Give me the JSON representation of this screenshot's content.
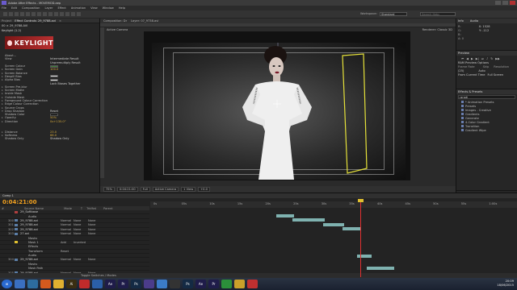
{
  "window": {
    "title": "Adobe After Effects - MOVEMOD.aep"
  },
  "menu": [
    "File",
    "Edit",
    "Composition",
    "Layer",
    "Effect",
    "Animation",
    "View",
    "Window",
    "Help"
  ],
  "toolbar": {
    "workspace_label": "Workspace:",
    "workspace": "Standard",
    "search_placeholder": "Search Help"
  },
  "left_panel": {
    "tabs": [
      "Project",
      "Effect Controls: 29_9788.avi",
      "×"
    ],
    "layer": "00 × 29_9788.AVI",
    "effect_name": "Keylight (1.2)",
    "banner": "KEYLIGHT",
    "properties": [
      {
        "name": "About...",
        "value": "",
        "swatch": "",
        "tw": ""
      },
      {
        "name": "View",
        "value": "Intermediate Result",
        "swatch": "",
        "tw": ""
      },
      {
        "name": "",
        "value": "Unpremultiply Result",
        "swatch": "",
        "tw": ""
      },
      {
        "name": "Screen Colour",
        "value": "",
        "swatch": "#3e7f3a",
        "tw": ""
      },
      {
        "name": "Screen Gain",
        "value": "100.0",
        "swatch": "",
        "tw": "▸"
      },
      {
        "name": "Screen Balance",
        "value": "",
        "swatch": "",
        "tw": "▸"
      },
      {
        "name": "Despill Bias",
        "value": "",
        "swatch": "#d8d8d8",
        "tw": "▸"
      },
      {
        "name": "Alpha Bias",
        "value": "",
        "swatch": "#d8d8d8",
        "tw": "▸"
      },
      {
        "name": "",
        "value": "Lock Biases Together",
        "swatch": "",
        "tw": ""
      },
      {
        "name": "Screen Pre-blur",
        "value": "",
        "swatch": "",
        "tw": "▸"
      },
      {
        "name": "Screen Matte",
        "value": "",
        "swatch": "",
        "tw": "▸"
      },
      {
        "name": "Inside Mask",
        "value": "",
        "swatch": "",
        "tw": "▸"
      },
      {
        "name": "Outside Mask",
        "value": "",
        "swatch": "",
        "tw": "▸"
      },
      {
        "name": "Foreground Colour Correction",
        "value": "",
        "swatch": "",
        "tw": "▸"
      },
      {
        "name": "Edge Colour Correction",
        "value": "",
        "swatch": "",
        "tw": "▸"
      },
      {
        "name": "Source Crops",
        "value": "",
        "swatch": "",
        "tw": "▸"
      },
      {
        "name": "Drop Shadow",
        "value": "Reset",
        "swatch": "",
        "tw": "▾"
      },
      {
        "name": "Shadow Color",
        "value": "",
        "swatch": "#000000",
        "tw": ""
      },
      {
        "name": "Opacity",
        "value": "50%",
        "swatch": "",
        "tw": "▸"
      },
      {
        "name": "Direction",
        "value": "0x+135.0°",
        "swatch": "",
        "tw": "▸"
      },
      {
        "name": "",
        "value": "",
        "swatch": "",
        "tw": ""
      },
      {
        "name": "",
        "value": "",
        "swatch": "",
        "tw": ""
      },
      {
        "name": "Distance",
        "value": "23.0",
        "swatch": "",
        "tw": "▸"
      },
      {
        "name": "Softness",
        "value": "66.0",
        "swatch": "",
        "tw": "▸"
      },
      {
        "name": "Shadow Only",
        "value": "Shadow Only",
        "swatch": "",
        "tw": ""
      }
    ]
  },
  "viewer": {
    "tabs": [
      "Composition: Dr",
      "Layer: 07_9738.avi"
    ],
    "view_label": "Active Camera",
    "renderer_label": "Renderer:",
    "renderer": "Classic 3D",
    "controls": [
      "75%",
      "0:04:21:00",
      "Full",
      "Active Camera",
      "1 View",
      "+0.0"
    ]
  },
  "right_panel": {
    "info": {
      "title": "Info",
      "x": "X: 1528",
      "y": "Y: -112",
      "r": "R:",
      "g": "G:",
      "b": "B:",
      "a": "A: 0"
    },
    "audio": {
      "title": "Audio"
    },
    "preview": {
      "title": "Preview",
      "ram_label": "RAM Preview Options",
      "frame_rate_label": "Frame Rate",
      "frame_rate": "(25)",
      "skip_label": "Skip",
      "resolution_label": "Resolution",
      "resolution": "Auto",
      "from_current": "From Current Time",
      "full_screen": "Full Screen"
    },
    "effects": {
      "title": "Effects & Presets",
      "search": "gradi",
      "items": [
        "* Animation Presets",
        "Presets",
        "Images - Creative",
        "Gradients",
        "Generate",
        "4-Color Gradient",
        "Transition",
        "Gradient Wipe"
      ]
    }
  },
  "timeline": {
    "tab": "Comp 1",
    "timecode": "0:04:21:00",
    "columns": [
      "#",
      "Source Name",
      "Mode",
      "T",
      "TrkMat",
      "Parent"
    ],
    "rows": [
      {
        "num": "",
        "name": "29_Softbase",
        "mode": "",
        "trk": "",
        "parent": "",
        "sub": false,
        "color": "#b04040"
      },
      {
        "num": "",
        "name": "Audio",
        "mode": "",
        "trk": "",
        "parent": "",
        "sub": true,
        "color": ""
      },
      {
        "num": "300",
        "name": "29_9788.avi",
        "mode": "Normal",
        "trk": "None",
        "parent": "None",
        "sub": false,
        "color": "#5c7fa8"
      },
      {
        "num": "301",
        "name": "29_9788.avi",
        "mode": "Normal",
        "trk": "None",
        "parent": "None",
        "sub": false,
        "color": "#5c7fa8"
      },
      {
        "num": "302",
        "name": "29_9788.avi",
        "mode": "Normal",
        "trk": "None",
        "parent": "None",
        "sub": false,
        "color": "#5c7fa8"
      },
      {
        "num": "303",
        "name": "27.avi",
        "mode": "Normal",
        "trk": "None",
        "parent": "None",
        "sub": false,
        "color": "#5c7fa8"
      },
      {
        "num": "",
        "name": "Masks",
        "mode": "",
        "trk": "",
        "parent": "",
        "sub": true,
        "color": ""
      },
      {
        "num": "",
        "name": "Mask 1",
        "mode": "Add",
        "trk": "Inverted",
        "parent": "",
        "sub": true,
        "color": "#e0c030"
      },
      {
        "num": "",
        "name": "Effects",
        "mode": "",
        "trk": "",
        "parent": "",
        "sub": true,
        "color": ""
      },
      {
        "num": "",
        "name": "Transform",
        "mode": "Reset",
        "trk": "",
        "parent": "",
        "sub": true,
        "color": ""
      },
      {
        "num": "",
        "name": "Audio",
        "mode": "",
        "trk": "",
        "parent": "",
        "sub": true,
        "color": ""
      },
      {
        "num": "304",
        "name": "29_9788.avi",
        "mode": "Normal",
        "trk": "None",
        "parent": "None",
        "sub": false,
        "color": "#5c7fa8"
      },
      {
        "num": "",
        "name": "Masks",
        "mode": "",
        "trk": "",
        "parent": "",
        "sub": true,
        "color": ""
      },
      {
        "num": "",
        "name": "Mask Path",
        "mode": "",
        "trk": "",
        "parent": "",
        "sub": true,
        "color": ""
      },
      {
        "num": "305",
        "name": "29_9788.avi",
        "mode": "Normal",
        "trk": "None",
        "parent": "None",
        "sub": false,
        "color": "#5c7fa8"
      }
    ],
    "ruler_labels": [
      "0s",
      "05s",
      "10s",
      "15s",
      "20s",
      "25s",
      "30s",
      "35s",
      "40s",
      "45s",
      "50s",
      "55s",
      "1:00s"
    ],
    "bottom_label": "Toggle Switches / Modes"
  },
  "taskbar": {
    "apps": [
      {
        "label": "",
        "color": "#3a6fc0"
      },
      {
        "label": "",
        "color": "#2d6c9e"
      },
      {
        "label": "",
        "color": "#d35a1e"
      },
      {
        "label": "",
        "color": "#e0b030"
      },
      {
        "label": "Ai",
        "color": "#3a2e12"
      },
      {
        "label": "",
        "color": "#c02b2b"
      },
      {
        "label": "",
        "color": "#2b5fa8"
      },
      {
        "label": "Ae",
        "color": "#1f1c4a"
      },
      {
        "label": "Pr",
        "color": "#1f1c4a"
      },
      {
        "label": "Ps",
        "color": "#142a44"
      },
      {
        "label": "",
        "color": "#4b3c8a"
      },
      {
        "label": "",
        "color": "#3b7bc8"
      },
      {
        "label": "",
        "color": "#333"
      },
      {
        "label": "Ps",
        "color": "#142a44"
      },
      {
        "label": "Ae",
        "color": "#1f1c4a"
      },
      {
        "label": "Pr",
        "color": "#1f1c4a"
      },
      {
        "label": "",
        "color": "#2b8f3a"
      },
      {
        "label": "",
        "color": "#caa02a"
      },
      {
        "label": "",
        "color": "#c03030"
      }
    ],
    "time": "20:09",
    "date": "18/06/2015"
  }
}
